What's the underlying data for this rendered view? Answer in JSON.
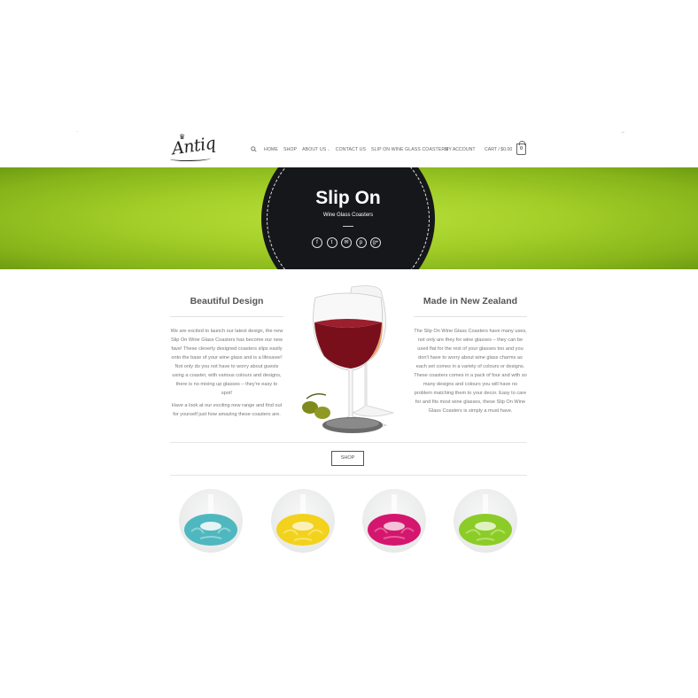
{
  "header": {
    "logo_text": "Antiq",
    "nav": [
      {
        "label": "HOME"
      },
      {
        "label": "SHOP"
      },
      {
        "label": "ABOUT US"
      },
      {
        "label": "CONTACT US"
      },
      {
        "label": "SLIP ON WINE GLASS COASTERS"
      }
    ],
    "account_label": "MY ACCOUNT",
    "cart_label": "CART / $0.00",
    "cart_count": "0"
  },
  "hero": {
    "title": "Slip On",
    "subtitle": "Wine Glass Coasters",
    "social_icons": [
      "facebook-icon",
      "twitter-icon",
      "email-icon",
      "pinterest-icon",
      "google-plus-icon"
    ],
    "social_glyphs": [
      "f",
      "t",
      "✉",
      "p",
      "g+"
    ]
  },
  "left_column": {
    "heading": "Beautiful Design",
    "paragraph1": "We are excited to launch our latest design, the new Slip On Wine Glass Coasters has become our new fave! These cleverly designed coasters slips easily onto the base of your wine glass and is a lifesaver! Not only do you not have to worry about guests using a coaster, with various colours and designs, there is no mixing up glasses – they're easy to spot!",
    "paragraph2": "Have a look at our exciting new range and find out for yourself just how amazing these coasters are."
  },
  "right_column": {
    "heading": "Made in New Zealand",
    "paragraph1": "The Slip On Wine Glass Coasters have many uses, not only are they for wine glasses – they can be used flat for the rest of your glasses too and you don't have to worry about wine glass charms as each set comes in a variety of colours or designs. These coasters comes in a pack of four and with so many designs and colours you will have no problem matching them to your decor. Easy to care for and fits most wine glasses, these Slip On Wine Glass Coasters is simply a must have."
  },
  "shop_button": "SHOP",
  "products": [
    {
      "color": "#4fb7bf"
    },
    {
      "color": "#f2d21c"
    },
    {
      "color": "#d4166e"
    },
    {
      "color": "#8ccc28"
    }
  ],
  "colors": {
    "banner_green": "#a2cd28",
    "hero_dark": "#15171a"
  }
}
